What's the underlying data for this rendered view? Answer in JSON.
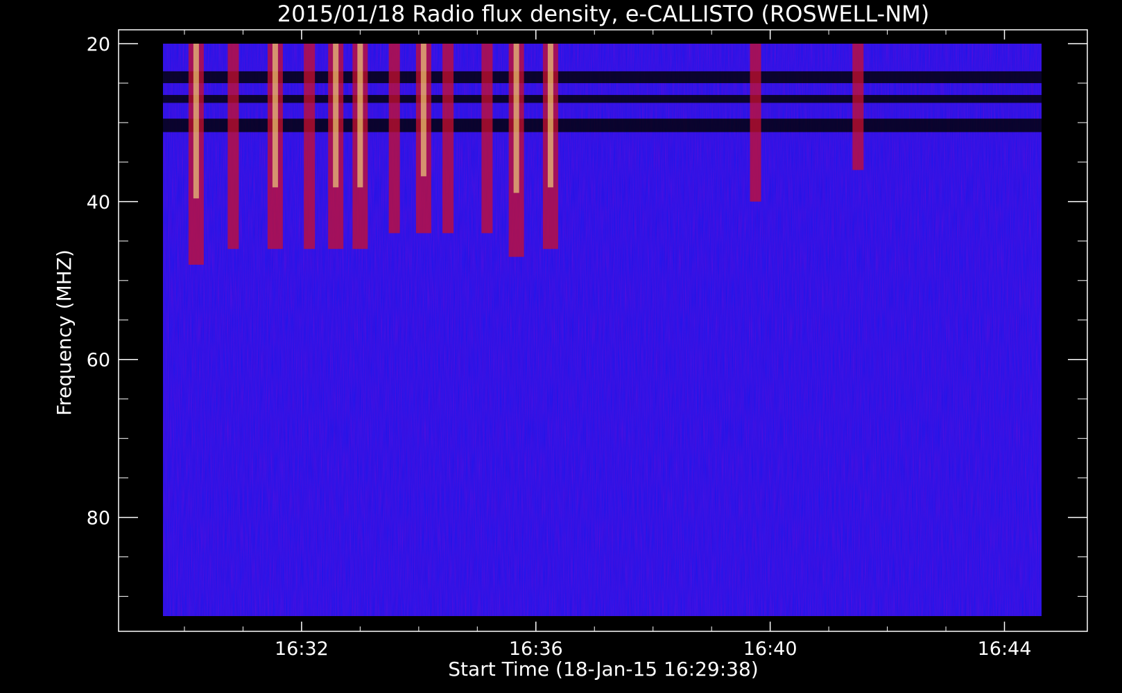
{
  "chart_data": {
    "type": "heatmap",
    "title": "2015/01/18  Radio flux density, e-CALLISTO (ROSWELL-NM)",
    "xlabel": "Start Time (18-Jan-15 16:29:38)",
    "ylabel": "Frequency (MHZ)",
    "x_unit": "UT time",
    "x_data_range": [
      "16:29:38",
      "16:44:38"
    ],
    "y_data_range": [
      20,
      92.5
    ],
    "y_inverted": true,
    "xticks": [
      "16:32",
      "16:36",
      "16:40",
      "16:44"
    ],
    "yticks": [
      20,
      40,
      60,
      80
    ],
    "colormap": {
      "background": "#0000ff",
      "low": "#000000",
      "mid": "#c8102e",
      "high": "#ffff80"
    },
    "bursts": [
      {
        "time": "16:30:12",
        "freq_range": [
          20,
          48
        ],
        "intensity": "high"
      },
      {
        "time": "16:30:50",
        "freq_range": [
          20,
          46
        ],
        "intensity": "medium"
      },
      {
        "time": "16:31:33",
        "freq_range": [
          20,
          46
        ],
        "intensity": "high"
      },
      {
        "time": "16:32:08",
        "freq_range": [
          20,
          46
        ],
        "intensity": "medium"
      },
      {
        "time": "16:32:35",
        "freq_range": [
          20,
          46
        ],
        "intensity": "high"
      },
      {
        "time": "16:33:00",
        "freq_range": [
          20,
          46
        ],
        "intensity": "high"
      },
      {
        "time": "16:33:35",
        "freq_range": [
          20,
          44
        ],
        "intensity": "medium"
      },
      {
        "time": "16:34:05",
        "freq_range": [
          20,
          44
        ],
        "intensity": "high"
      },
      {
        "time": "16:34:30",
        "freq_range": [
          20,
          44
        ],
        "intensity": "medium"
      },
      {
        "time": "16:35:10",
        "freq_range": [
          20,
          44
        ],
        "intensity": "medium"
      },
      {
        "time": "16:35:40",
        "freq_range": [
          20,
          47
        ],
        "intensity": "high"
      },
      {
        "time": "16:36:15",
        "freq_range": [
          20,
          46
        ],
        "intensity": "high"
      },
      {
        "time": "16:39:45",
        "freq_range": [
          20,
          40
        ],
        "intensity": "low"
      },
      {
        "time": "16:41:30",
        "freq_range": [
          20,
          36
        ],
        "intensity": "medium"
      }
    ]
  }
}
